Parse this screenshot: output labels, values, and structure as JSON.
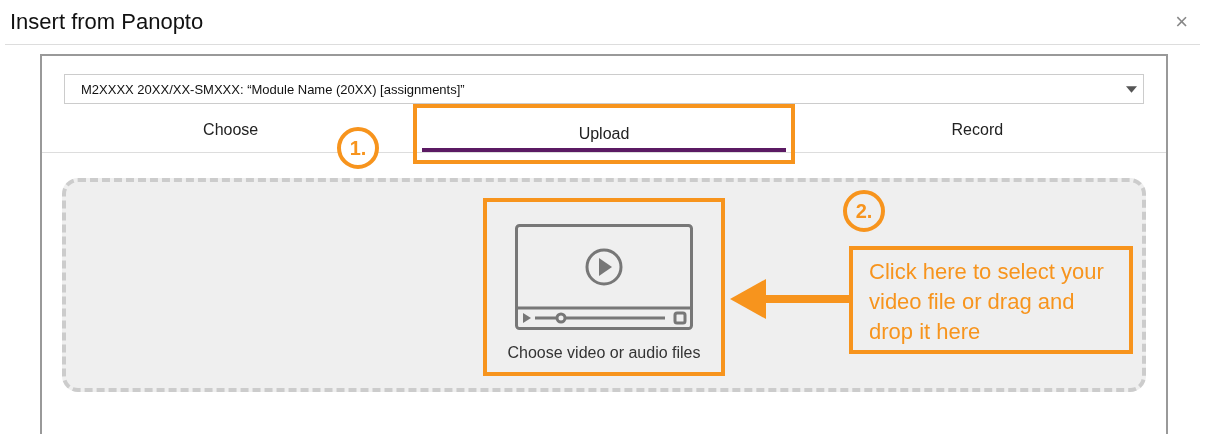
{
  "window": {
    "title": "Insert from Panopto",
    "close": "×"
  },
  "folder_select": {
    "value": "M2XXXX 20XX/XX-SMXXX: “Module Name (20XX) [assignments]”"
  },
  "tabs": [
    {
      "label": "Choose",
      "selected": false,
      "highlighted": false
    },
    {
      "label": "Upload",
      "selected": true,
      "highlighted": true
    },
    {
      "label": "Record",
      "selected": false,
      "highlighted": false
    }
  ],
  "drop_zone": {
    "label": "Choose video or audio files",
    "highlighted": true
  },
  "annotations": [
    {
      "kind": "step",
      "text": "1."
    },
    {
      "kind": "step",
      "text": "2."
    },
    {
      "kind": "callout",
      "text": "Click here to select your video file or drag and drop it here"
    }
  ]
}
